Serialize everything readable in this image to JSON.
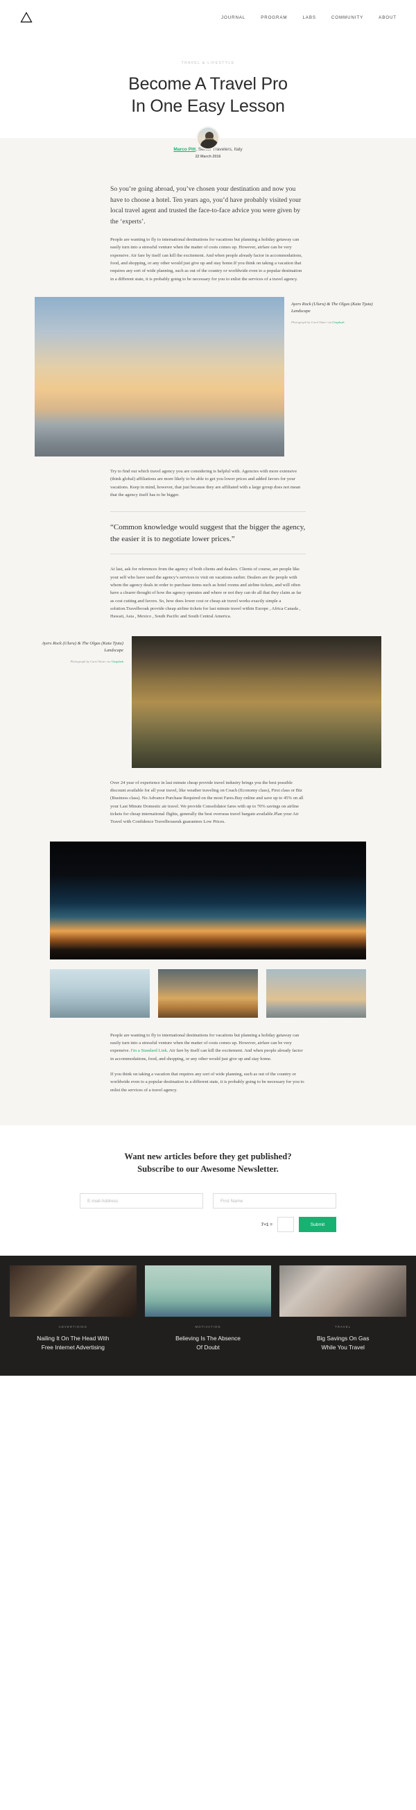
{
  "nav": {
    "logo_icon": "triangle-logo-icon",
    "links": [
      {
        "label": "JOURNAL"
      },
      {
        "label": "PROGRAM"
      },
      {
        "label": "LABS"
      },
      {
        "label": "COMMUNITY"
      },
      {
        "label": "ABOUT"
      }
    ]
  },
  "hero": {
    "kicker": "TRAVEL & LIFESTYLE",
    "title_line1": "Become A Travel Pro",
    "title_line2": "In One Easy Lesson"
  },
  "byline": {
    "avatar_icon": "author-avatar",
    "author": "Marco Pitt",
    "role": ", Senior Travelers, Italy",
    "date": "22 March 2016",
    "author_color": "#1aaf6b"
  },
  "article": {
    "lead": "So you’re going abroad, you’ve chosen your destination and now you have to choose a hotel. Ten years ago, you’d have probably visited your local travel agent and trusted the face-to-face advice you were given by the ‘experts’.",
    "para_1": "People are wanting to fly to international destinations for vacations but planning a holiday getaway can easily turn into a stressful venture when the matter of costs comes up. However, airfare can be very expensive. Air fare by itself can kill the excitement. And when people already factor in accommodations, food, and shopping, or any other would just give up and stay home.If you think on taking a vacation that requires any sort of wide planning, such as out of the country or worldwide even to a popular destination in a different state, it is probably going to be necessary for you to enlist the services of a travel agency.",
    "para_2": "Try to find out which travel agency you are considering is helpful with. Agencies with more extensive (think global) affiliations are more likely to be able to get you lower prices and added favors for your vacations. Keep in mind, however, that just because they are affiliated with a large group does not mean that the agency itself has to be bigger.",
    "pullquote": "“Common knowledge would suggest that the bigger the agency, the easier it is to negotiate lower prices.”",
    "para_3": "At last, ask for references from the agency of both clients and dealers. Clients of course, are people like your self who have used the agency’s services to visit on vacations earlier. Dealers are the people with whom the agency deals in order to purchase items such as hotel rooms and airline tickets, and will often have a clearer thought of how the agency operates and where or not they can do all that they claim as far as cost cutting and favors. So, how does lower cost or cheap air travel works exactly simple a solution.Travelbooak provide cheap airline tickets for last minute travel within Europe , Africa Canada , Hawaii, Asia , Mexico , South Pacific and South Central America.",
    "para_4": "Over 24 year of experience in last minute cheap provide travel industry brings you the best possible discount available for all your travel, like weather traveling on Coach (Economy class), First class or Biz (Business class). No Advance Purchase Required on the most Fares.Buy online and save up to 45% on all your Last Minute Domestic air travel. We provide Consolidator fares with up to 70% savings on airline tickets for cheap international flights, generally the best overseas travel bargain available.Plan your Air Travel with Confidence Travelbouseuk guarantees Low Prices.",
    "para_5_a": "People are wanting to fly to international destinations for vacations but planning a holiday getaway can easily turn into a stressful venture when the matter of costs comes up. However, airfare can be very expensive. ",
    "para_5_link": "I'm a Standard Link",
    "para_5_b": ". Air fare by itself can kill the excitement. And when people already factor in accommodations, food, and shopping, or any other would just give up and stay home.",
    "para_6": "If you think on taking a vacation that requires any sort of wide planning, such as out of the country or worldwide even to a popular destination in a different state, it is probably going to be necessary for you to enlist the services of a travel agency.",
    "link_color": "#1aaf6b"
  },
  "figures": {
    "fig1": {
      "image_name": "sunset-seascape-photo",
      "caption_title": "Ayers Rock (Uluru) & The Olgas (Kata Tjuta) Landscape",
      "credit_prefix": "Photograph by Carol Slater via ",
      "credit_link": "Unsplash"
    },
    "fig2": {
      "image_name": "uluru-landscape-photo",
      "caption_title": "Ayers Rock (Uluru) & The Olgas (Kata Tjuta) Landscape",
      "credit_prefix": "Photograph by Carol Slater via ",
      "credit_link": "Unsplash"
    },
    "fig3": {
      "image_name": "night-mountain-photo"
    },
    "thumbs": [
      {
        "image_name": "misty-mountains-thumb"
      },
      {
        "image_name": "golden-road-thumb"
      },
      {
        "image_name": "coastal-sunset-thumb"
      }
    ]
  },
  "newsletter": {
    "title_line1": "Want new articles before they get published?",
    "title_line2": "Subscribe to our Awesome Newsletter.",
    "email_placeholder": "E-mail Address",
    "email_value": "",
    "firstname_placeholder": "First Name",
    "firstname_value": "",
    "captcha_label": "7+1 =",
    "captcha_value": "",
    "submit_label": "Submit",
    "submit_color": "#17b272"
  },
  "footer": {
    "cards": [
      {
        "image_name": "laptop-desk-photo",
        "category": "ADVERTISING",
        "title_line1": "Nailing It On The Head With",
        "title_line2": "Free Internet Advertising"
      },
      {
        "image_name": "blue-hair-woman-photo",
        "category": "MOTIVATION",
        "title_line1": "Believing Is The Absence",
        "title_line2": "Of Doubt"
      },
      {
        "image_name": "travelers-backpacks-photo",
        "category": "TRAVEL",
        "title_line1": "Big Savings On Gas",
        "title_line2": "While You Travel"
      }
    ]
  }
}
